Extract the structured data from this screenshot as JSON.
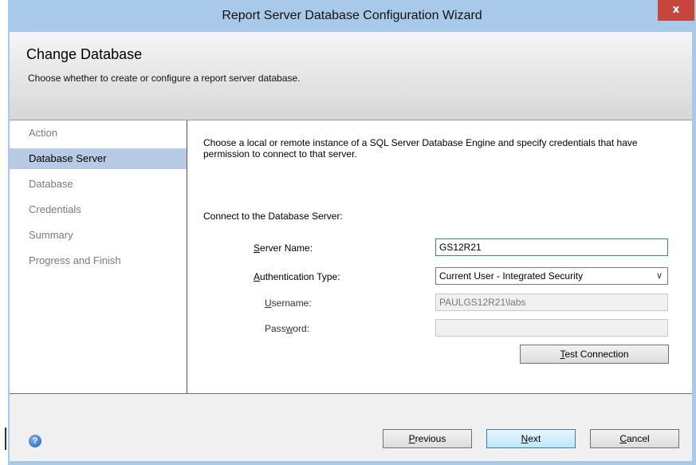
{
  "window": {
    "title": "Report Server Database Configuration Wizard",
    "close_glyph": "x"
  },
  "header": {
    "title": "Change Database",
    "subtitle": "Choose whether to create or configure a report server database."
  },
  "nav": {
    "items": [
      {
        "label": "Action",
        "active": false
      },
      {
        "label": "Database Server",
        "active": true
      },
      {
        "label": "Database",
        "active": false
      },
      {
        "label": "Credentials",
        "active": false
      },
      {
        "label": "Summary",
        "active": false
      },
      {
        "label": "Progress and Finish",
        "active": false
      }
    ]
  },
  "main": {
    "description": "Choose a local or remote instance of a SQL Server Database Engine and specify credentials that have permission to connect to that server.",
    "connect_label": "Connect to the Database Server:",
    "server_name": {
      "label_mnemonic": "S",
      "label_rest": "erver Name:",
      "value": "GS12R21"
    },
    "auth_type": {
      "label_mnemonic": "A",
      "label_rest": "uthentication Type:",
      "value": "Current User - Integrated Security"
    },
    "username": {
      "label_mnemonic": "U",
      "label_rest": "sername:",
      "value": "PAULGS12R21\\labs"
    },
    "password": {
      "label_pre": "Pass",
      "label_mnemonic": "w",
      "label_rest": "ord:",
      "value": ""
    },
    "test_connection": {
      "mnemonic": "T",
      "rest": "est Connection"
    }
  },
  "footer": {
    "help_icon": "help-icon",
    "previous": {
      "mnemonic": "P",
      "rest": "revious"
    },
    "next": {
      "mnemonic": "N",
      "rest": "ext"
    },
    "cancel": {
      "mnemonic": "C",
      "rest": "ancel"
    }
  },
  "colors": {
    "title_bar": "#a9c9ea",
    "close_button": "#c7453d",
    "nav_active": "#b7cce4",
    "focus_border": "#3c7fb1"
  }
}
